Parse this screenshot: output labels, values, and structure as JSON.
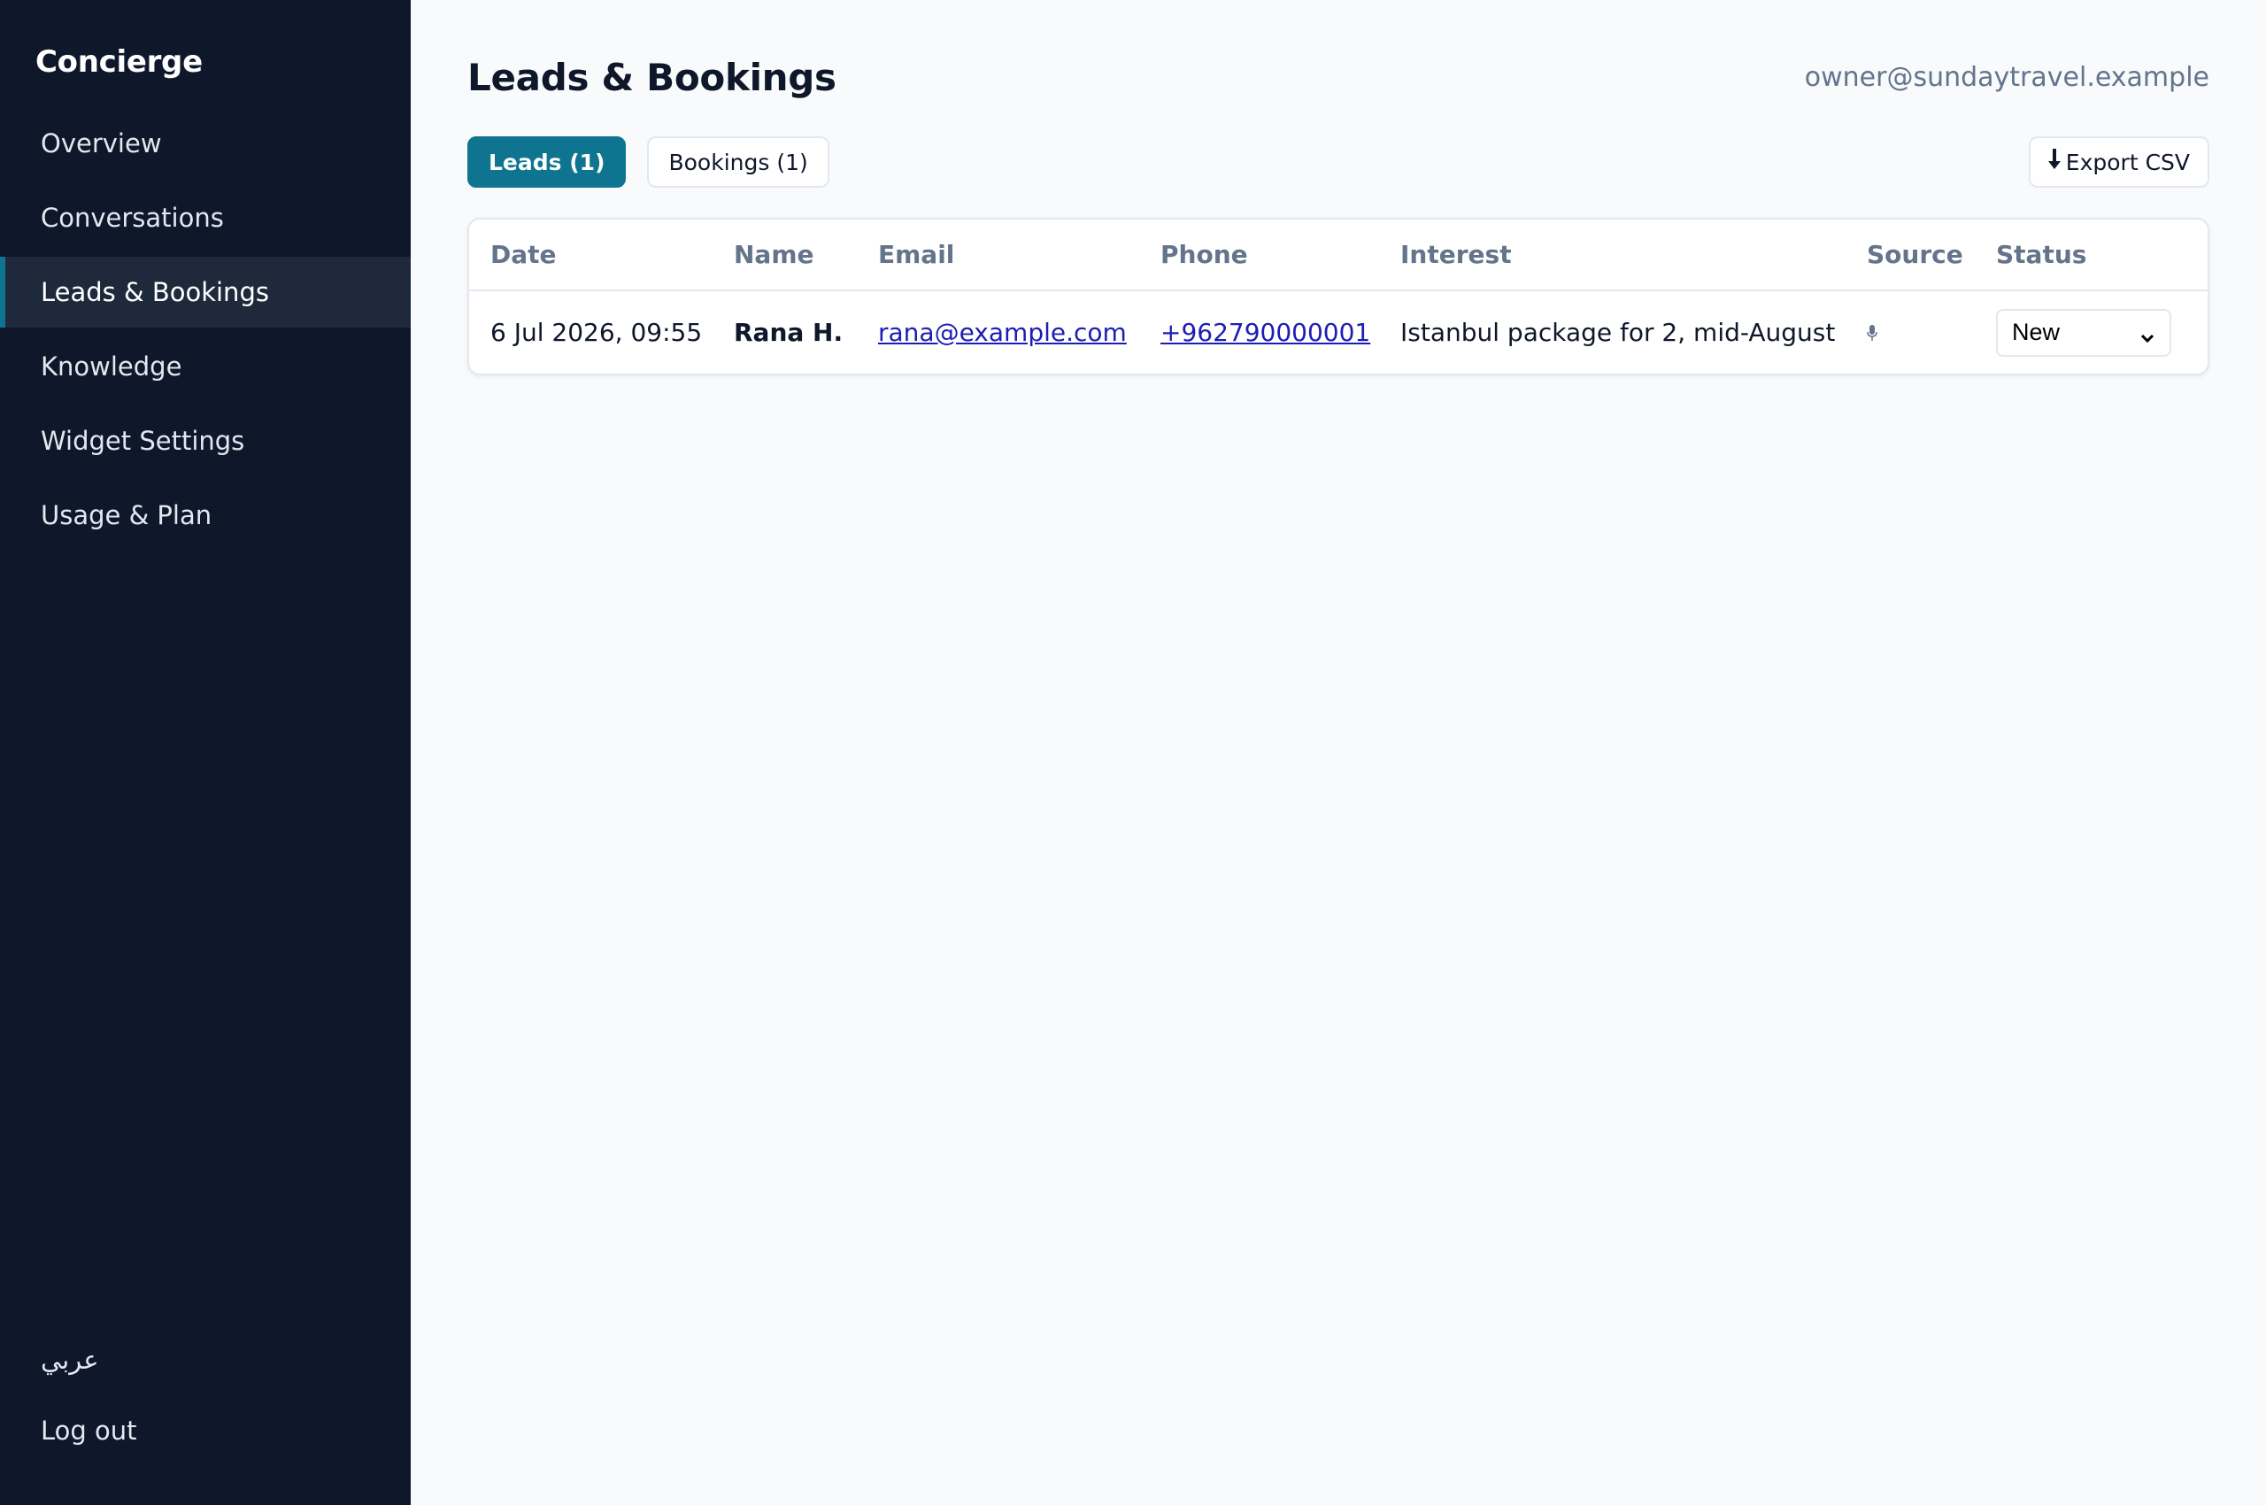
{
  "sidebar": {
    "brand": "Concierge",
    "items": [
      {
        "label": "Overview"
      },
      {
        "label": "Conversations"
      },
      {
        "label": "Leads & Bookings"
      },
      {
        "label": "Knowledge"
      },
      {
        "label": "Widget Settings"
      },
      {
        "label": "Usage & Plan"
      }
    ],
    "bottom": [
      {
        "label": "عربي"
      },
      {
        "label": "Log out"
      }
    ]
  },
  "header": {
    "title": "Leads & Bookings",
    "user_email": "owner@sundaytravel.example"
  },
  "tabs": [
    {
      "label": "Leads (1)",
      "active": true
    },
    {
      "label": "Bookings (1)",
      "active": false
    }
  ],
  "export": {
    "label": "Export CSV",
    "icon": "download-arrow-icon"
  },
  "table": {
    "columns": [
      "Date",
      "Name",
      "Email",
      "Phone",
      "Interest",
      "Source",
      "Status"
    ],
    "rows": [
      {
        "date": "6 Jul 2026, 09:55",
        "name": "Rana H.",
        "email": "rana@example.com",
        "phone": "+962790000001",
        "interest": "Istanbul package for 2, mid-August",
        "source_icon": "microphone-icon",
        "status": "New"
      }
    ]
  },
  "colors": {
    "sidebar_bg": "#0f172a",
    "accent": "#0e7490",
    "link": "#1d1db5"
  }
}
